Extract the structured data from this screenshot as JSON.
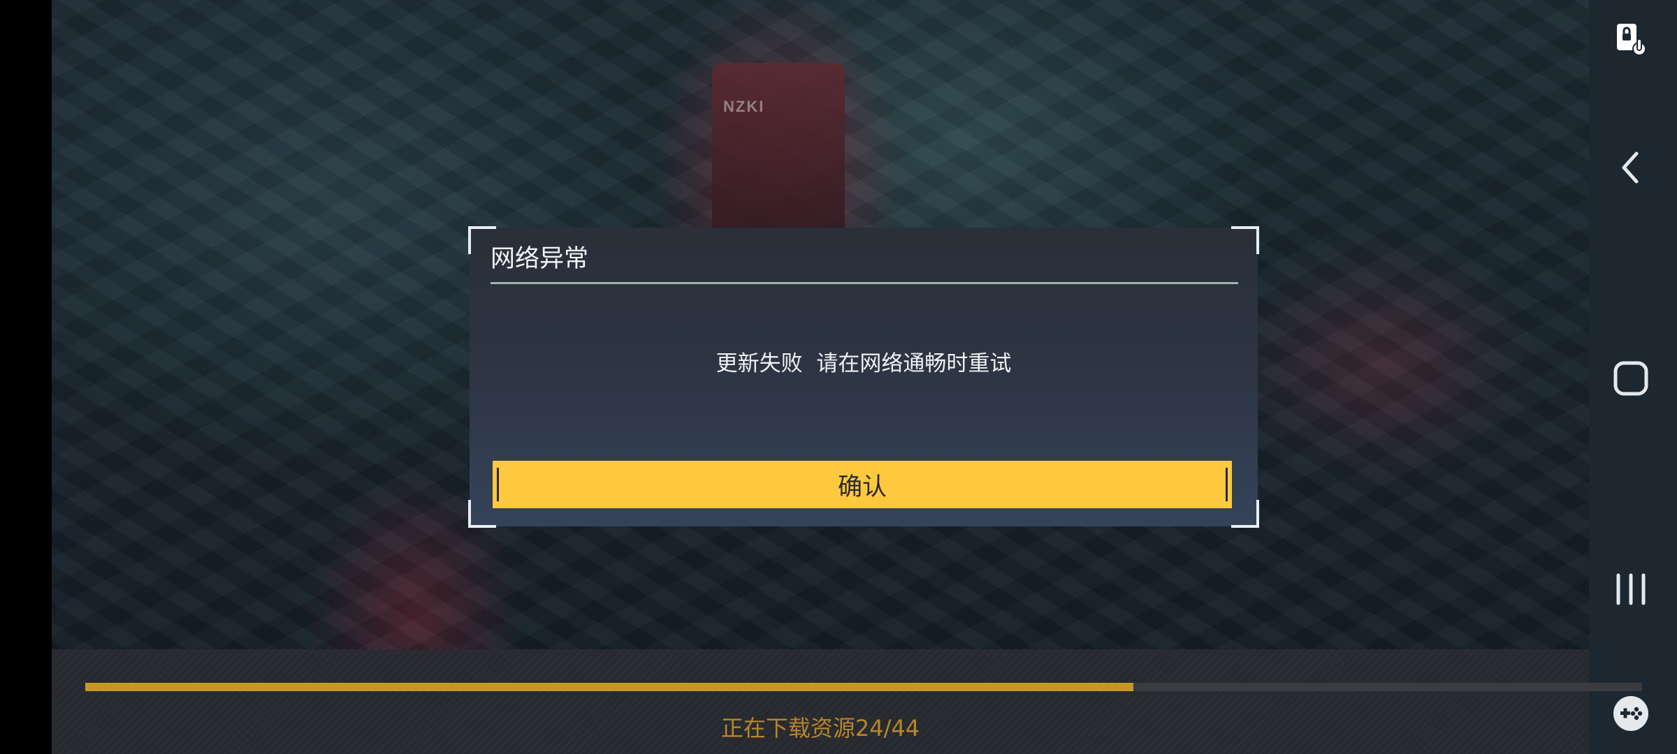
{
  "dialog": {
    "title": "网络异常",
    "message": "更新失败  请在网络通畅时重试",
    "confirm_label": "确认"
  },
  "download": {
    "status_text": "正在下载资源24/44",
    "progress_fraction": 0.6733
  },
  "scene": {
    "tower_sign": "NZKI"
  },
  "system_nav": {
    "icons": [
      "screen-lock-touch-icon",
      "back-icon",
      "home-icon",
      "recents-icon",
      "game-controller-icon"
    ]
  },
  "colors": {
    "accent_yellow": "#ffc93f",
    "progress_gold": "#c8971f",
    "dialog_bg": "#2d3442"
  }
}
